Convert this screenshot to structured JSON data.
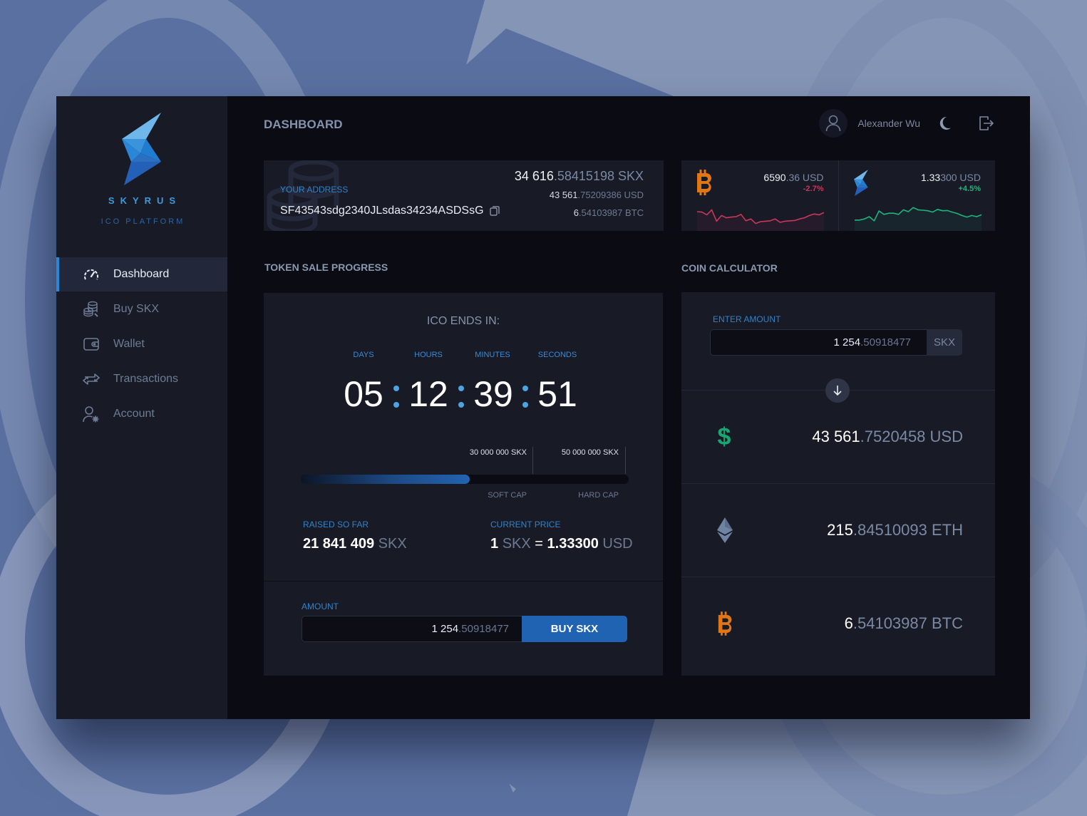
{
  "brand": {
    "name": "SKYRUS",
    "tagline": "ICO PLATFORM"
  },
  "sidebar": {
    "items": [
      {
        "label": "Dashboard",
        "icon": "speedometer-icon",
        "active": true
      },
      {
        "label": "Buy SKX",
        "icon": "coins-icon",
        "active": false
      },
      {
        "label": "Wallet",
        "icon": "wallet-icon",
        "active": false
      },
      {
        "label": "Transactions",
        "icon": "exchange-arrows-icon",
        "active": false
      },
      {
        "label": "Account",
        "icon": "user-settings-icon",
        "active": false
      }
    ]
  },
  "header": {
    "title": "DASHBOARD",
    "user_name": "Alexander Wu",
    "icons": [
      "user-avatar-icon",
      "moon-icon",
      "logout-icon"
    ]
  },
  "address_card": {
    "label": "YOUR ADDRESS",
    "address": "SF43543sdg2340JLsdas34234ASDSsG",
    "balance_skx_int": "34 616",
    "balance_skx_dec": ".58415198 SKX",
    "balance_usd_int": "43 561",
    "balance_usd_dec": ".75209386 USD",
    "balance_btc_int": "6",
    "balance_btc_dec": ".54103987 BTC"
  },
  "tickers": [
    {
      "coin": "BTC",
      "icon": "bitcoin-icon",
      "price_int": "6590",
      "price_dec": ".36 USD",
      "change": "-2.7%",
      "color": "#c9375b",
      "sparkline": [
        0.72,
        0.7,
        0.58,
        0.8,
        0.3,
        0.55,
        0.45,
        0.48,
        0.5,
        0.6,
        0.32,
        0.4,
        0.2,
        0.28,
        0.3,
        0.32,
        0.4,
        0.25,
        0.3,
        0.32,
        0.33,
        0.4,
        0.45,
        0.55,
        0.62,
        0.58,
        0.68
      ]
    },
    {
      "coin": "SKX",
      "icon": "skyrus-logo-icon",
      "price_int": "1.33",
      "price_dec": "300 USD",
      "change": "+4.5%",
      "color": "#1db67a",
      "sparkline": [
        0.35,
        0.35,
        0.4,
        0.5,
        0.32,
        0.75,
        0.6,
        0.65,
        0.65,
        0.6,
        0.8,
        0.72,
        0.9,
        0.8,
        0.78,
        0.76,
        0.7,
        0.82,
        0.76,
        0.77,
        0.7,
        0.64,
        0.55,
        0.48,
        0.55,
        0.5,
        0.58
      ]
    }
  ],
  "token_sale": {
    "section_title": "TOKEN SALE PROGRESS",
    "ends_label": "ICO ENDS IN:",
    "countdown": [
      {
        "label": "DAYS",
        "value": "05"
      },
      {
        "label": "HOURS",
        "value": "12"
      },
      {
        "label": "MINUTES",
        "value": "39"
      },
      {
        "label": "SECONDS",
        "value": "51"
      }
    ],
    "progress_fraction": 0.515,
    "soft_cap_value": "30 000 000 SKX",
    "soft_cap_label": "SOFT CAP",
    "hard_cap_value": "50 000 000 SKX",
    "hard_cap_label": "HARD CAP",
    "raised_label": "RAISED SO FAR",
    "raised_value": "21 841 409",
    "raised_unit": "SKX",
    "price_label": "CURRENT PRICE",
    "price_qty": "1",
    "price_unit_from": "SKX",
    "price_eq": "=",
    "price_value": "1.33300",
    "price_unit_to": "USD",
    "amount_label": "AMOUNT",
    "amount_int": "1 254",
    "amount_dec": ".50918477",
    "buy_button": "BUY SKX"
  },
  "calculator": {
    "section_title": "COIN CALCULATOR",
    "enter_label": "ENTER AMOUNT",
    "amount_int": "1 254",
    "amount_dec": ".50918477",
    "amount_unit": "SKX",
    "swap_icon": "arrow-down-icon",
    "results": [
      {
        "icon": "dollar-icon",
        "int": "43 561",
        "dec": ".7520458",
        "unit": "USD",
        "color": "#16a873"
      },
      {
        "icon": "ethereum-icon",
        "int": "215",
        "dec": ".84510093",
        "unit": "ETH",
        "color": "#6f83a3"
      },
      {
        "icon": "bitcoin-icon",
        "int": "6",
        "dec": ".54103987",
        "unit": "BTC",
        "color": "#e07714"
      }
    ]
  }
}
